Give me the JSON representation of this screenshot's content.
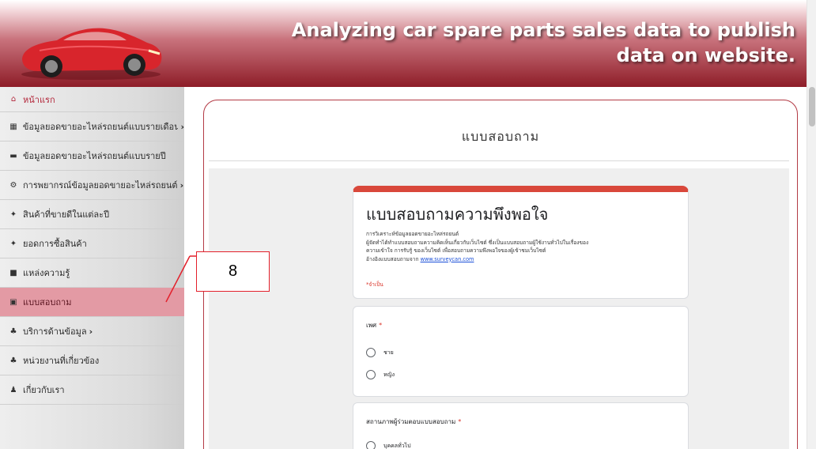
{
  "header": {
    "title": "Analyzing car spare parts sales data to publish data on website.",
    "logo_icon": "sports-car-logo",
    "accent_color": "#8e1d28"
  },
  "sidebar": {
    "items": [
      {
        "icon": "home-icon",
        "glyph": "⌂",
        "label": "หน้าแรก",
        "chevron": ""
      },
      {
        "icon": "calendar-icon",
        "glyph": "▦",
        "label": "ข้อมูลยอดขายอะไหล่รถยนต์แบบรายเดือน",
        "chevron": "›"
      },
      {
        "icon": "calendar-icon",
        "glyph": "▬",
        "label": "ข้อมูลยอดขายอะไหล่รถยนต์แบบรายปี",
        "chevron": ""
      },
      {
        "icon": "network-icon",
        "glyph": "⚙",
        "label": "การพยากรณ์ข้อมูลยอดขายอะไหล่รถยนต์",
        "chevron": "›"
      },
      {
        "icon": "magic-wand-icon",
        "glyph": "✦",
        "label": "สินค้าที่ขายดีในแต่ละปี",
        "chevron": ""
      },
      {
        "icon": "magic-wand-icon",
        "glyph": "✦",
        "label": "ยอดการซื้อสินค้า",
        "chevron": ""
      },
      {
        "icon": "book-icon",
        "glyph": "■",
        "label": "แหล่งความรู้",
        "chevron": ""
      },
      {
        "icon": "document-icon",
        "glyph": "▣",
        "label": "แบบสอบถาม",
        "chevron": ""
      },
      {
        "icon": "sitemap-icon",
        "glyph": "♣",
        "label": "บริการด้านข้อมูล",
        "chevron": "›"
      },
      {
        "icon": "sitemap-icon",
        "glyph": "♣",
        "label": "หน่วยงานที่เกี่ยวข้อง",
        "chevron": ""
      },
      {
        "icon": "user-icon",
        "glyph": "♟",
        "label": "เกี่ยวกับเรา",
        "chevron": ""
      }
    ],
    "active_index": 7
  },
  "content": {
    "panel_title": "แบบสอบถาม",
    "form": {
      "title": "แบบสอบถามความพึงพอใจ",
      "desc_line1": "การวิเคราะห์ข้อมูลยอดขายอะไหล่รถยนต์",
      "desc_line2": "ผู้จัดทำได้ทำแบบสอบถามความคิดเห็นเกี่ยวกับเว็บไซต์ ซึ่งเป็นแบบสอบถามผู้ใช้งานทั่วไปในเรื่องของ",
      "desc_line3": "ความเข้าใจ การรับรู้ ของเว็บไซต์ เพื่อสอบถามความพึงพอใจของผู้เข้าชมเว็บไซต์",
      "desc_line4_prefix": "อ้างอิงแบบสอบถามจาก",
      "desc_link": "www.surveycan.com",
      "required_note": "*จำเป็น",
      "q1": {
        "label": "เพศ",
        "required": "*",
        "options": [
          "ชาย",
          "หญิง"
        ]
      },
      "q2": {
        "label": "สถานภาพผู้ร่วมตอบแบบสอบถาม",
        "required": "*",
        "options": [
          "บุคคลทั่วไป"
        ]
      }
    },
    "accent_color": "#d9483b"
  },
  "callout": {
    "number": "8",
    "color": "#e3202b"
  }
}
